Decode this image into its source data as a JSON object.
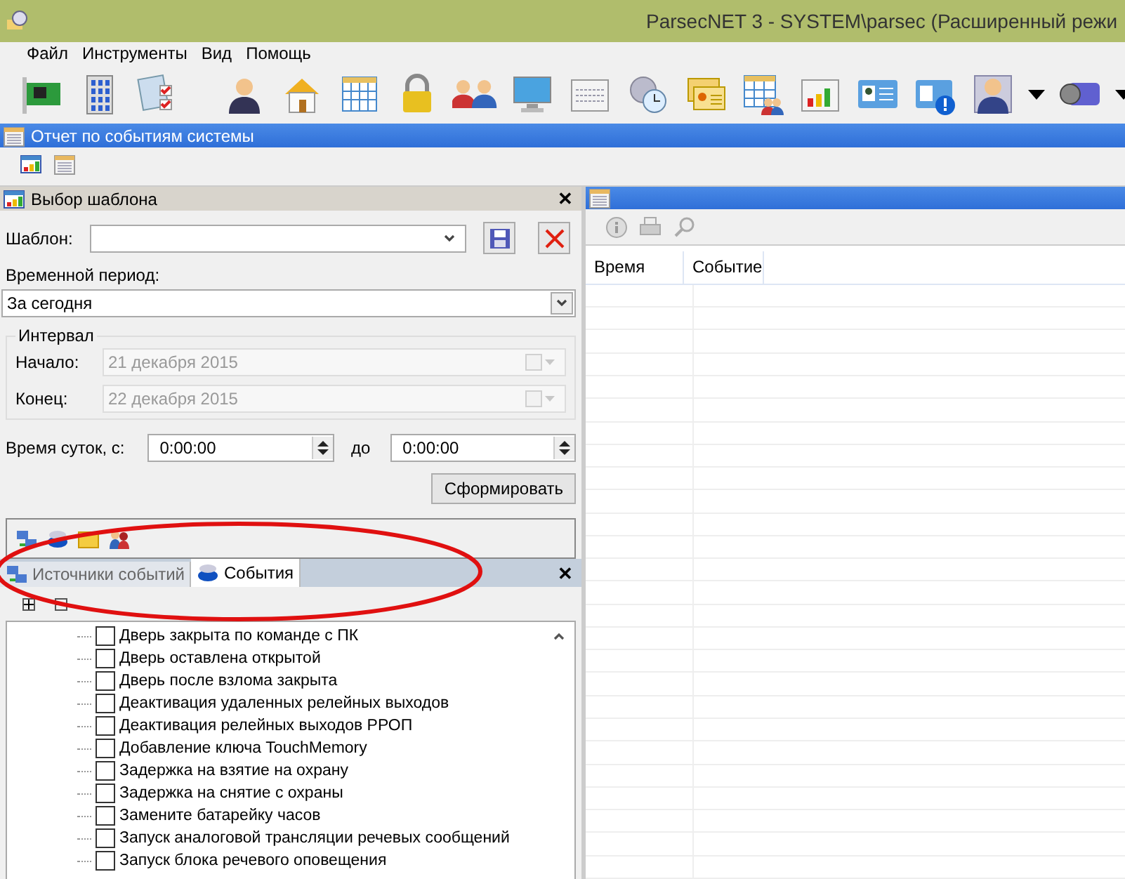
{
  "window": {
    "title": "ParsecNET 3 - SYSTEM\\parsec (Расширенный режи"
  },
  "menu": [
    "Файл",
    "Инструменты",
    "Вид",
    "Помощь"
  ],
  "document": {
    "title": "Отчет по событиям системы"
  },
  "template_panel": {
    "title": "Выбор шаблона",
    "close": "✕",
    "template_label": "Шаблон:",
    "period_label": "Временной период:",
    "period_value": "За сегодня",
    "interval": {
      "title": "Интервал",
      "start_label": "Начало:",
      "start_value": "21 декабря  2015",
      "end_label": "Конец:",
      "end_value": "22 декабря  2015",
      "disabled": true
    },
    "time_label": "Время суток, с:",
    "time_from": "0:00:00",
    "time_to_label": "до",
    "time_to": "0:00:00",
    "generate_button": "Сформировать"
  },
  "tabs_close": "✕",
  "tabs": [
    {
      "label": "Источники событий",
      "selected": false
    },
    {
      "label": "События",
      "selected": true
    }
  ],
  "events": [
    {
      "label": "Дверь закрыта по команде с ПК",
      "checked": false
    },
    {
      "label": "Дверь оставлена открытой",
      "checked": false
    },
    {
      "label": "Дверь после взлома закрыта",
      "checked": false
    },
    {
      "label": "Деактивация  удаленных релейных выходов",
      "checked": false
    },
    {
      "label": "Деактивация релейных выходов РРОП",
      "checked": false
    },
    {
      "label": "Добавление ключа TouchMemory",
      "checked": false
    },
    {
      "label": "Задержка на взятие на охрану",
      "checked": false
    },
    {
      "label": "Задержка на снятие с охраны",
      "checked": false
    },
    {
      "label": "Замените батарейку часов",
      "checked": false
    },
    {
      "label": "Запуск аналоговой трансляции речевых сообщений",
      "checked": false
    },
    {
      "label": "Запуск блока речевого оповещения",
      "checked": false
    }
  ],
  "table": {
    "columns": [
      "Время",
      "Событие"
    ]
  }
}
